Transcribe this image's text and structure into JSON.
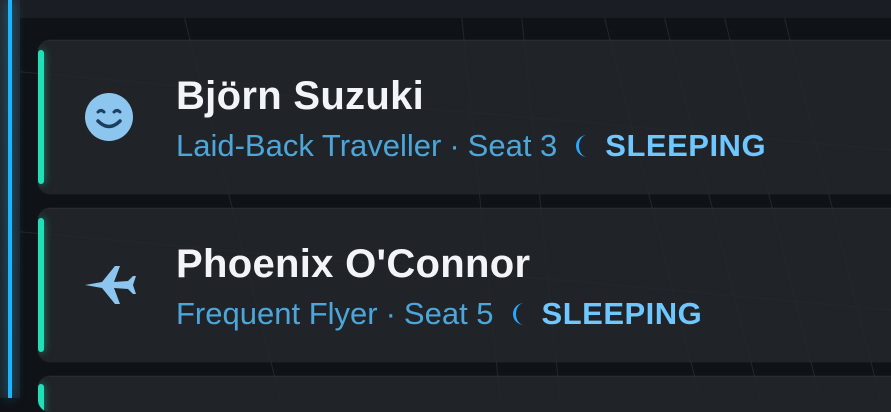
{
  "passengers": [
    {
      "name": "Björn Suzuki",
      "type": "Laid-Back Traveller",
      "separator": "·",
      "seat": "Seat 3",
      "status": "SLEEPING",
      "avatar_icon": "smile-icon"
    },
    {
      "name": "Phoenix O'Connor",
      "type": "Frequent Flyer",
      "separator": "·",
      "seat": "Seat 5",
      "status": "SLEEPING",
      "avatar_icon": "plane-icon"
    }
  ]
}
